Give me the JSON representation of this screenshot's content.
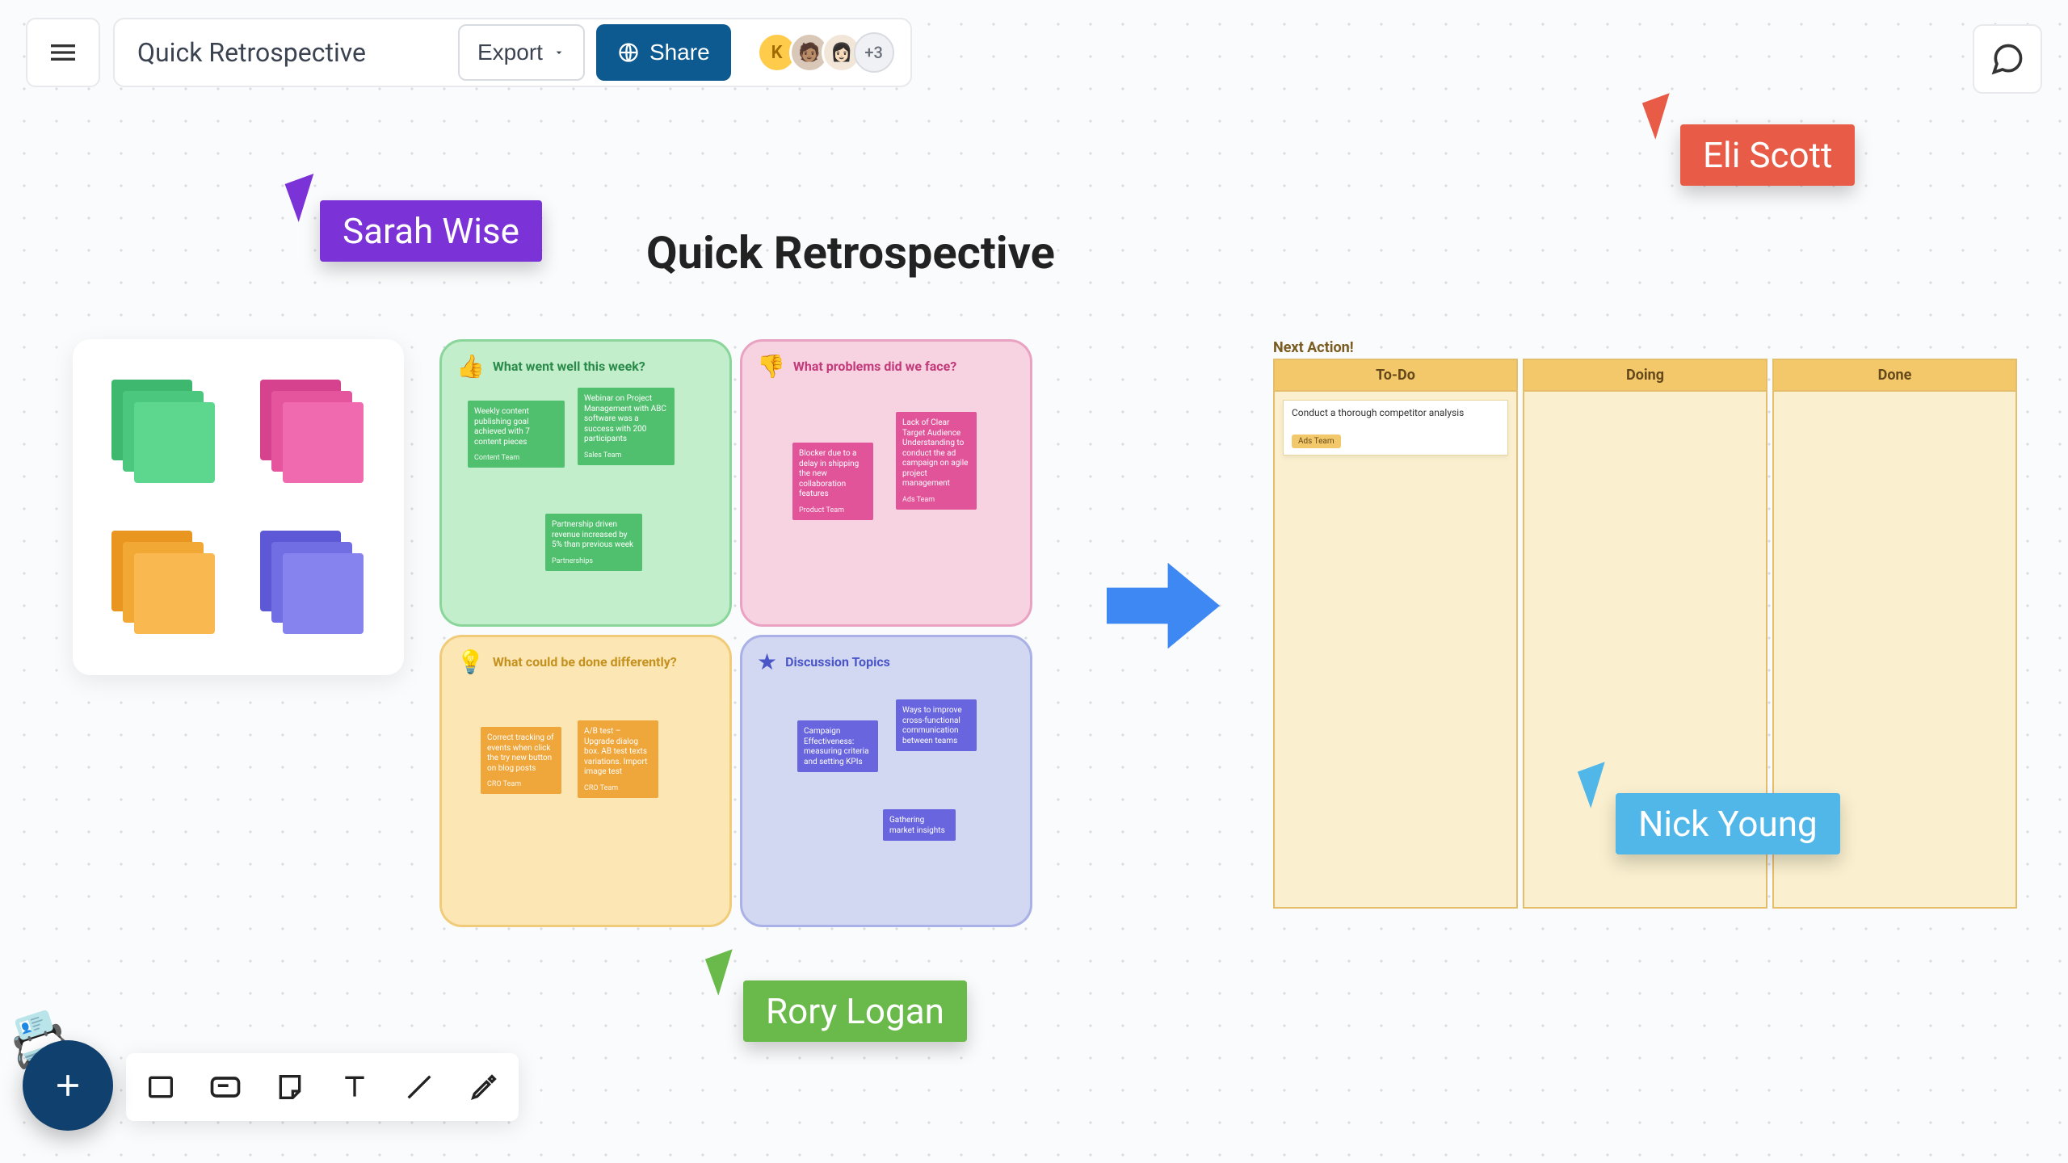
{
  "header": {
    "doc_title": "Quick Retrospective",
    "export_label": "Export",
    "share_label": "Share",
    "avatar_initial": "K",
    "avatar_more": "+3"
  },
  "canvas": {
    "title": "Quick Retrospective"
  },
  "cursors": {
    "sarah": "Sarah Wise",
    "eli": "Eli Scott",
    "rory": "Rory Logan",
    "nick": "Nick Young"
  },
  "quadrants": {
    "well": {
      "title": "What went well this week?",
      "icon": "👍"
    },
    "problems": {
      "title": "What problems did we face?",
      "icon": "👎"
    },
    "diff": {
      "title": "What could be done differently?",
      "icon": "💡"
    },
    "discuss": {
      "title": "Discussion Topics",
      "icon": "★"
    }
  },
  "notes": {
    "well": [
      {
        "text": "Weekly content publishing goal achieved with 7 content pieces",
        "team": "Content Team"
      },
      {
        "text": "Webinar on Project Management with ABC software was a success with 200 participants",
        "team": "Sales Team"
      },
      {
        "text": "Partnership driven revenue increased by 5% than previous week",
        "team": "Partnerships"
      }
    ],
    "problems": [
      {
        "text": "Blocker due to a delay in shipping the new collaboration features",
        "team": "Product Team"
      },
      {
        "text": "Lack of Clear Target Audience Understanding to conduct the ad campaign on agile project management",
        "team": "Ads Team"
      }
    ],
    "diff": [
      {
        "text": "Correct tracking of events when click the try new button on blog posts",
        "team": "CRO Team"
      },
      {
        "text": "A/B test – Upgrade dialog box. AB test texts variations. Import image test",
        "team": "CRO Team"
      }
    ],
    "discuss": [
      {
        "text": "Campaign Effectiveness: measuring criteria and setting KPIs",
        "team": ""
      },
      {
        "text": "Ways to improve cross-functional communication between teams",
        "team": ""
      },
      {
        "text": "Gathering market insights",
        "team": ""
      }
    ]
  },
  "kanban": {
    "title": "Next Action!",
    "columns": {
      "todo": "To-Do",
      "doing": "Doing",
      "done": "Done"
    },
    "cards": {
      "todo": [
        {
          "text": "Conduct a thorough competitor analysis",
          "tag": "Ads Team"
        }
      ]
    }
  }
}
